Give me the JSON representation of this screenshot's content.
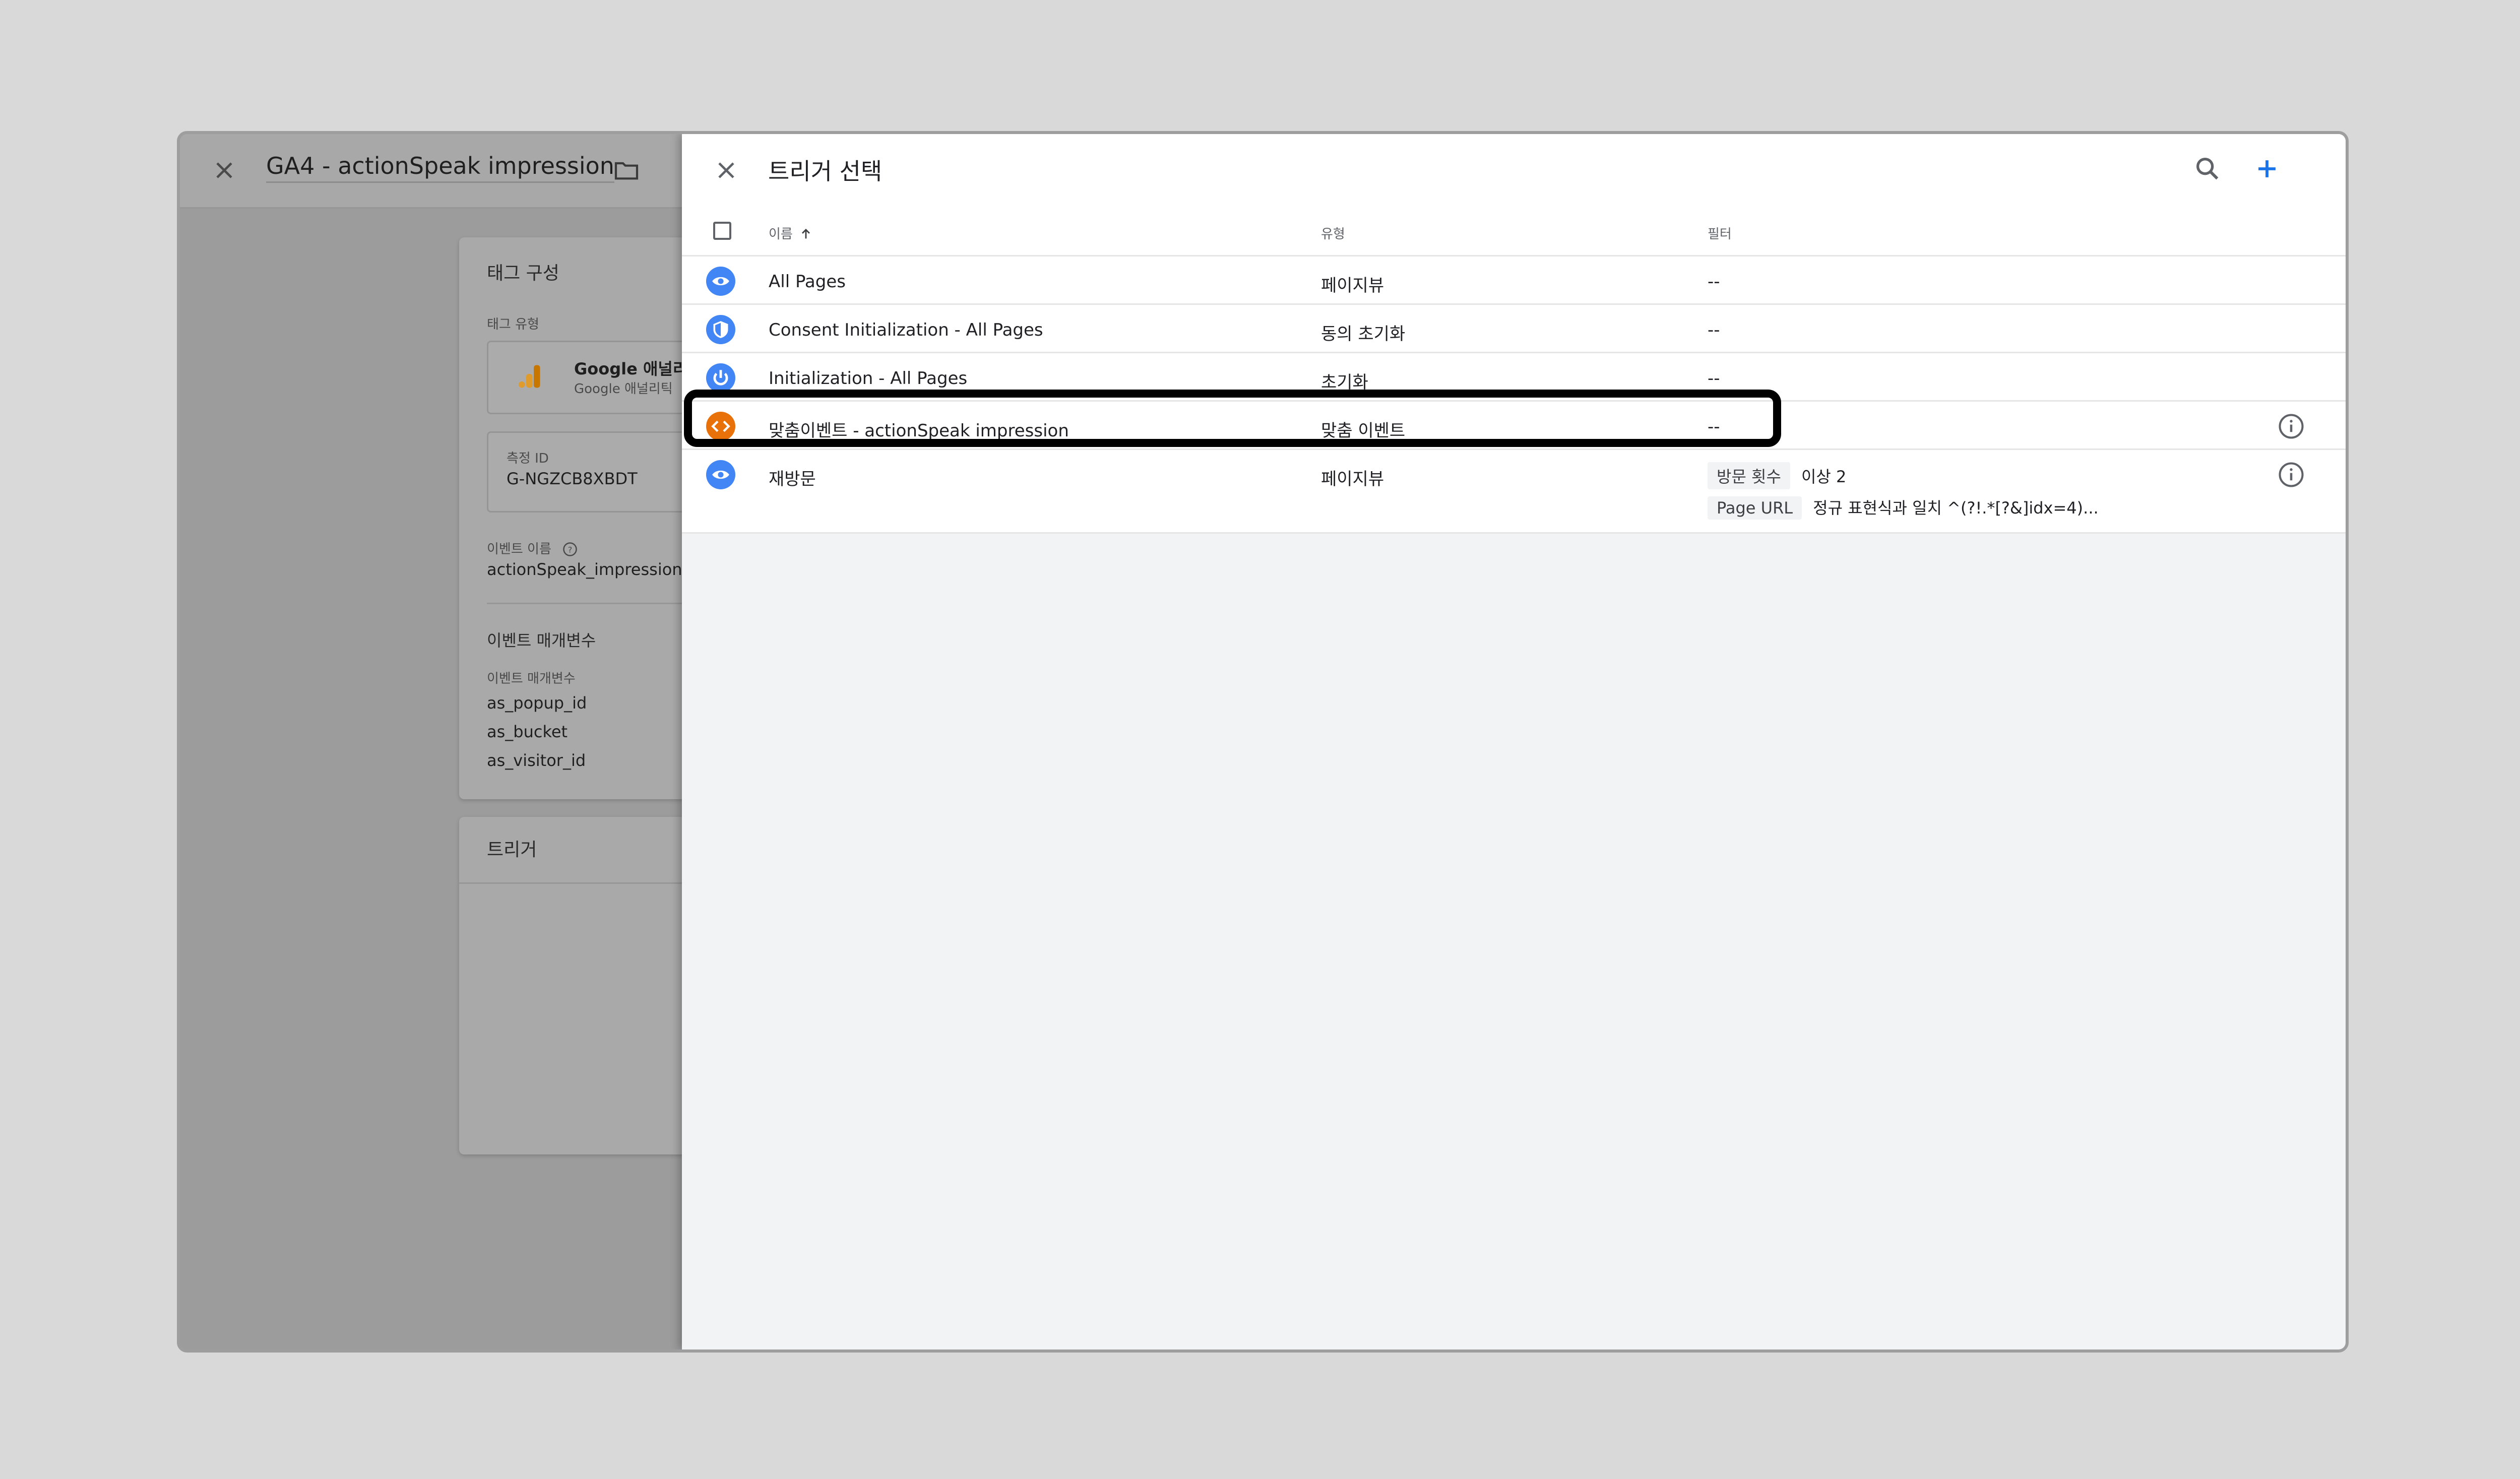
{
  "tag_editor": {
    "title": "GA4 - actionSpeak impression",
    "config_card": {
      "title": "태그 구성",
      "tag_type_label": "태그 유형",
      "tag_type_name": "Google 애널리",
      "tag_type_sub": "Google 애널리틱",
      "measurement_id_label": "측정 ID",
      "measurement_id_value": "G-NGZCB8XBDT",
      "event_name_label": "이벤트 이름",
      "event_name_value": "actionSpeak_impression",
      "event_params_section": "이벤트 매개변수",
      "event_params_label": "이벤트 매개변수",
      "event_params": [
        "as_popup_id",
        "as_bucket",
        "as_visitor_id"
      ]
    },
    "trigger_card": {
      "title": "트리거"
    }
  },
  "trigger_picker": {
    "title": "트리거 선택",
    "columns": {
      "name": "이름",
      "type": "유형",
      "filter": "필터"
    },
    "rows": [
      {
        "name": "All Pages",
        "type": "페이지뷰",
        "filter": "--",
        "icon": "eye-icon",
        "color": "#4285f4"
      },
      {
        "name": "Consent Initialization - All Pages",
        "type": "동의 초기화",
        "filter": "--",
        "icon": "shield-icon",
        "color": "#4285f4"
      },
      {
        "name": "Initialization - All Pages",
        "type": "초기화",
        "filter": "--",
        "icon": "power-icon",
        "color": "#4285f4"
      },
      {
        "name": "맞춤이벤트 - actionSpeak impression",
        "type": "맞춤 이벤트",
        "filter": "--",
        "icon": "code-icon",
        "color": "#e8710a"
      },
      {
        "name": "재방문",
        "type": "페이지뷰",
        "icon": "eye-icon",
        "color": "#4285f4",
        "filters": [
          {
            "chip": "방문 횟수",
            "text": "이상 2"
          },
          {
            "chip": "Page URL",
            "text": "정규 표현식과 일치 ^(?!.*[?&]idx=4)..."
          }
        ]
      }
    ]
  }
}
